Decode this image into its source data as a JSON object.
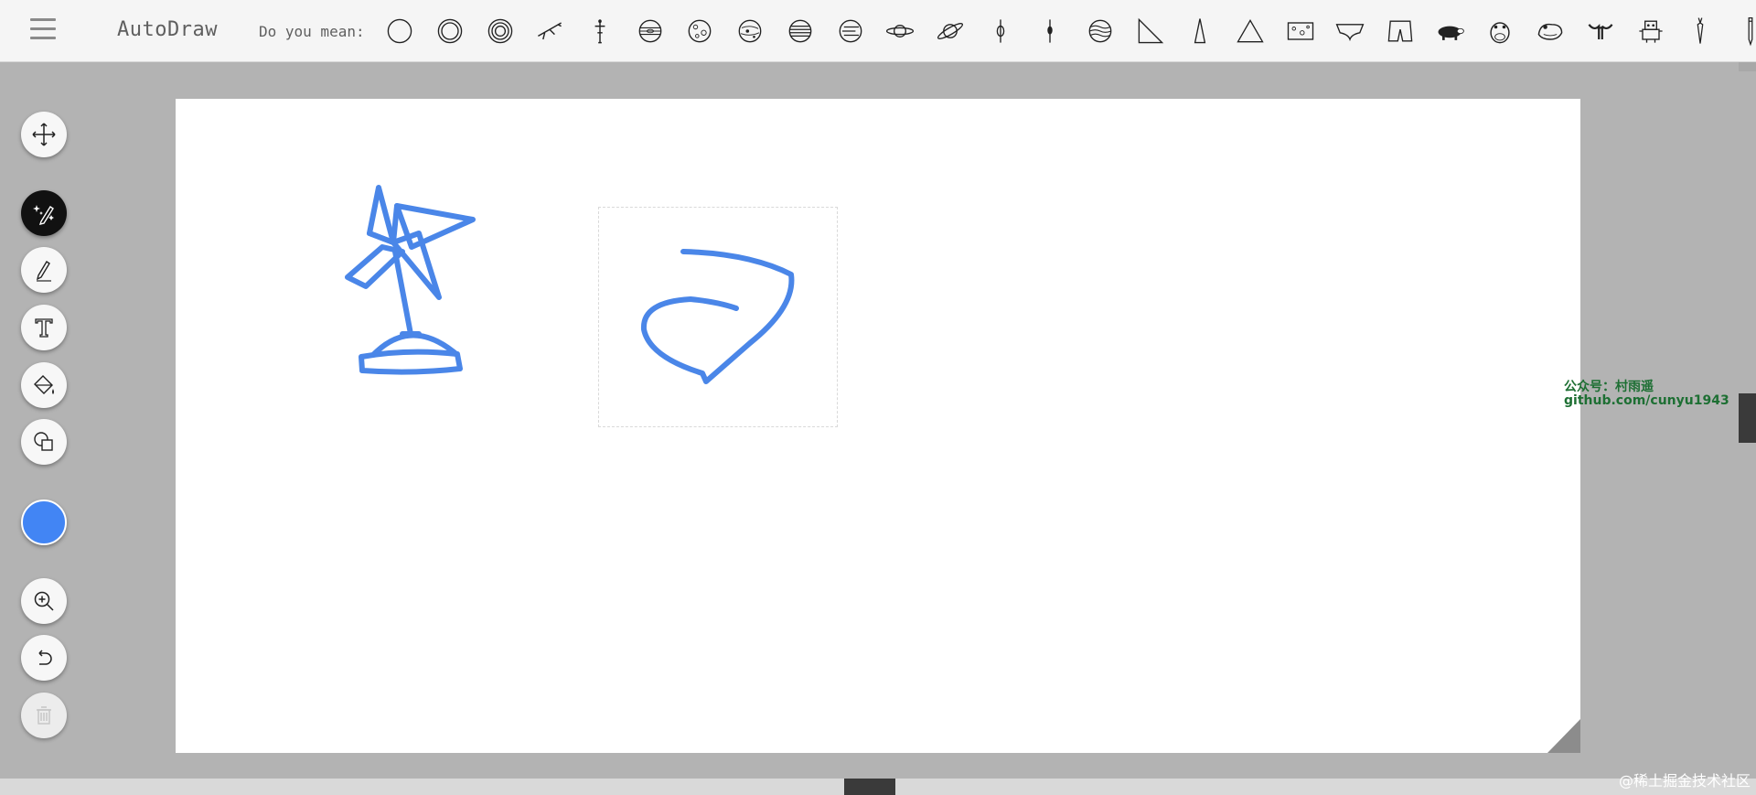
{
  "app": {
    "title": "AutoDraw",
    "menu_icon": "hamburger-menu-icon"
  },
  "suggestions": {
    "label": "Do you mean:",
    "items": [
      "circle-icon",
      "double-circle-icon",
      "triple-circle-icon",
      "flying-figure-icon",
      "figure-icon",
      "planet-banded-icon",
      "moon-icon",
      "planet-spotted-icon",
      "planet-striped-icon",
      "planet-ring-lines-icon",
      "saturn-icon",
      "saturn-tilted-icon",
      "pin-icon",
      "pin-thin-icon",
      "planet-wavy-icon",
      "right-triangle-icon",
      "thin-triangle-icon",
      "triangle-icon",
      "cheese-icon",
      "underwear-icon",
      "shorts-icon",
      "pig-icon",
      "hippo-icon",
      "frog-icon",
      "tribal-figure-icon",
      "robot-icon",
      "carrot-icon",
      "pencil-icon"
    ]
  },
  "tools": [
    {
      "name": "move-tool-button",
      "icon": "move-arrows-icon"
    },
    {
      "name": "autodraw-tool-button",
      "icon": "autodraw-sparkle-pencil-icon",
      "active": true
    },
    {
      "name": "draw-tool-button",
      "icon": "pencil-icon"
    },
    {
      "name": "type-tool-button",
      "icon": "text-t-icon"
    },
    {
      "name": "fill-tool-button",
      "icon": "paint-bucket-icon"
    },
    {
      "name": "shape-tool-button",
      "icon": "shapes-icon"
    },
    {
      "name": "zoom-button",
      "icon": "zoom-in-icon"
    },
    {
      "name": "undo-button",
      "icon": "undo-icon"
    },
    {
      "name": "delete-button",
      "icon": "trash-icon",
      "disabled": true
    }
  ],
  "color": {
    "current": "#4285f4",
    "stroke": "#4a86e8"
  },
  "watermark": {
    "line1": "公众号：村雨遥",
    "line2": "github.com/cunyu1943",
    "bottom": "@稀土掘金技术社区"
  }
}
